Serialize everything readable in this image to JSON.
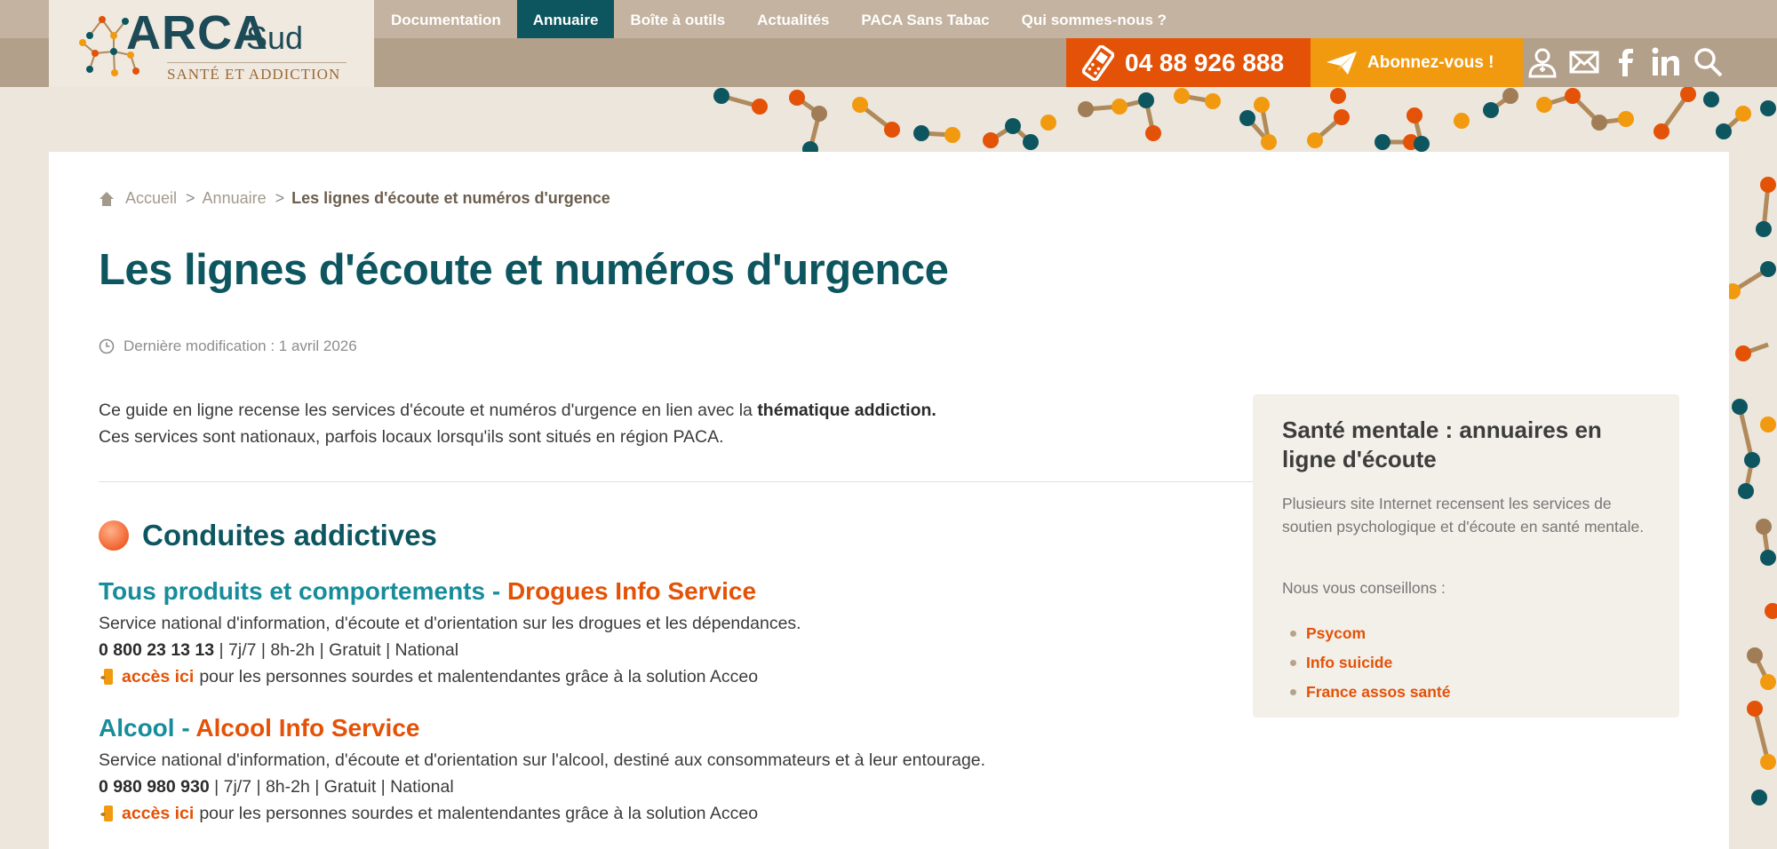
{
  "logo": {
    "name": "ARCA",
    "suffix": "Sud",
    "tagline": "SANTÉ ET ADDICTION"
  },
  "nav": [
    {
      "label": "Documentation",
      "active": false
    },
    {
      "label": "Annuaire",
      "active": true
    },
    {
      "label": "Boîte à outils",
      "active": false
    },
    {
      "label": "Actualités",
      "active": false
    },
    {
      "label": "PACA Sans Tabac",
      "active": false
    },
    {
      "label": "Qui sommes-nous ?",
      "active": false
    }
  ],
  "header": {
    "phone": "04 88 926 888",
    "subscribe": "Abonnez-vous !",
    "icons": [
      "user-doctor-icon",
      "mail-icon",
      "facebook-icon",
      "linkedin-icon",
      "search-icon"
    ]
  },
  "breadcrumb": {
    "home": "Accueil",
    "section": "Annuaire",
    "current": "Les lignes d'écoute et numéros d'urgence",
    "separator": ">"
  },
  "page": {
    "title": "Les lignes d'écoute et numéros d'urgence",
    "modified": "Dernière modification : 1 avril 2026",
    "intro_line1_prefix": "Ce guide en ligne recense les services d'écoute et numéros d'urgence en lien avec la ",
    "intro_line1_bold": "thématique addiction.",
    "intro_line2": "Ces services sont nationaux, parfois locaux lorsqu'ils sont situés en région PACA."
  },
  "section": {
    "title": "Conduites addictives",
    "entries": [
      {
        "category": "Tous produits et comportements - ",
        "service": "Drogues Info Service",
        "description": "Service national d'information, d'écoute et d'orientation sur les drogues et les dépendances.",
        "phone": "0 800 23 13 13",
        "details": " | 7j/7 | 8h-2h | Gratuit | National",
        "acceo_link": "accès ici",
        "acceo_text": "pour les personnes sourdes et malentendantes grâce à la solution Acceo"
      },
      {
        "category": "Alcool - ",
        "service": "Alcool Info Service",
        "description": "Service national d'information, d'écoute et d'orientation sur l'alcool, destiné aux consommateurs et à leur entourage.",
        "phone": "0 980 980 930",
        "details": " | 7j/7 | 8h-2h | Gratuit | National",
        "acceo_link": "accès ici",
        "acceo_text": "pour les personnes sourdes et malentendantes grâce à la solution Acceo"
      }
    ]
  },
  "sidebar": {
    "title": "Santé mentale : annuaires en ligne d'écoute",
    "text": "Plusieurs site Internet recensent les services de soutien psychologique et d'écoute en santé mentale.",
    "advice": "Nous vous conseillons :",
    "links": [
      "Psycom",
      "Info suicide",
      "France assos santé"
    ]
  },
  "colors": {
    "teal": "#0d5660",
    "teal_light": "#178c9b",
    "orange": "#e35207",
    "amber": "#f29a0f",
    "header_brown": "#b2a08a"
  }
}
